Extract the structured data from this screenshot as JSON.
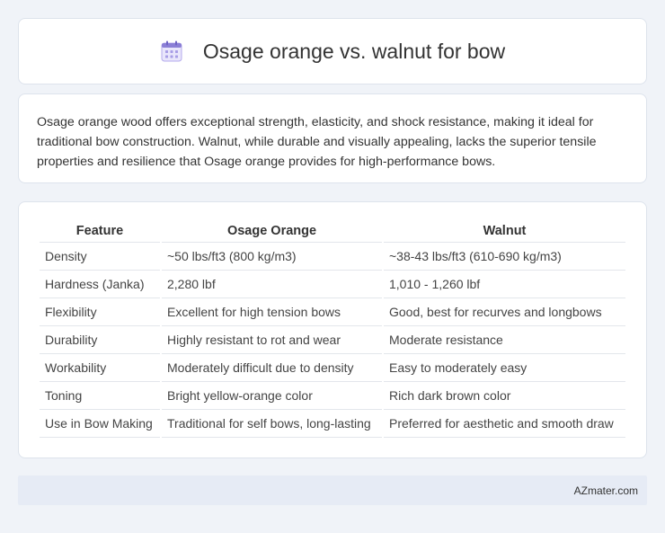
{
  "header": {
    "title": "Osage orange vs. walnut for bow",
    "icon": "calendar-icon"
  },
  "description": {
    "text": "Osage orange wood offers exceptional strength, elasticity, and shock resistance, making it ideal for traditional bow construction. Walnut, while durable and visually appealing, lacks the superior tensile properties and resilience that Osage orange provides for high-performance bows."
  },
  "table": {
    "headers": [
      "Feature",
      "Osage Orange",
      "Walnut"
    ],
    "rows": [
      [
        "Density",
        "~50 lbs/ft3 (800 kg/m3)",
        "~38-43 lbs/ft3 (610-690 kg/m3)"
      ],
      [
        "Hardness (Janka)",
        "2,280 lbf",
        "1,010 - 1,260 lbf"
      ],
      [
        "Flexibility",
        "Excellent for high tension bows",
        "Good, best for recurves and longbows"
      ],
      [
        "Durability",
        "Highly resistant to rot and wear",
        "Moderate resistance"
      ],
      [
        "Workability",
        "Moderately difficult due to density",
        "Easy to moderately easy"
      ],
      [
        "Toning",
        "Bright yellow-orange color",
        "Rich dark brown color"
      ],
      [
        "Use in Bow Making",
        "Traditional for self bows, long-lasting",
        "Preferred for aesthetic and smooth draw"
      ]
    ]
  },
  "footer": {
    "brand": "AZmater.com"
  },
  "colors": {
    "background": "#f0f3f8",
    "card": "#ffffff",
    "footer": "#e6ebf5",
    "icon_accent": "#8b7fd6"
  }
}
